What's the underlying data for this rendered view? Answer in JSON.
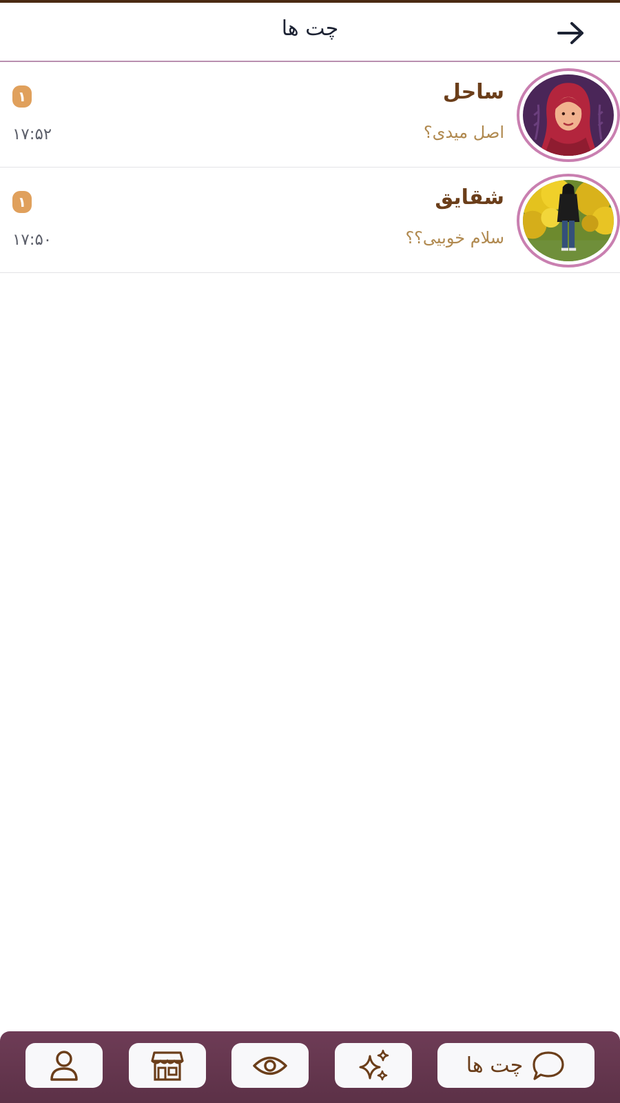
{
  "header": {
    "title": "چت ها",
    "back_icon": "arrow-right-icon"
  },
  "chats": [
    {
      "name": "ساحل",
      "preview": "اصل میدی؟",
      "time": "۱۷:۵۲",
      "unread": "۱",
      "avatar": "illustrated-woman-hijab"
    },
    {
      "name": "شقایق",
      "preview": "سلام خوبیی؟؟",
      "time": "۱۷:۵۰",
      "unread": "۱",
      "avatar": "photo-woman-yellow-bush"
    }
  ],
  "bottom_nav": {
    "items": [
      {
        "icon": "chat-bubble-icon",
        "label": "چت ها",
        "active": true
      },
      {
        "icon": "sparkles-icon"
      },
      {
        "icon": "eye-icon"
      },
      {
        "icon": "store-icon"
      },
      {
        "icon": "user-icon"
      }
    ]
  },
  "colors": {
    "accent_brown": "#6b3e1a",
    "preview_tan": "#b0894f",
    "badge_orange": "#e0a05c",
    "avatar_ring": "#c97fb0",
    "nav_bar": "#6e3c56"
  }
}
